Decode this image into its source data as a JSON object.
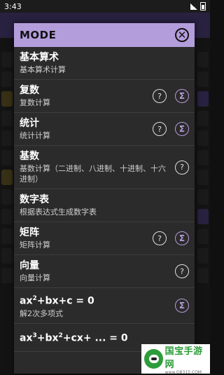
{
  "status_bar": {
    "time": "3:43"
  },
  "dialog": {
    "title": "MODE",
    "items": [
      {
        "title": "基本算术",
        "subtitle": "基本算术计算",
        "help": false,
        "sigma": false
      },
      {
        "title": "复数",
        "subtitle": "复数计算",
        "help": true,
        "sigma": true
      },
      {
        "title": "统计",
        "subtitle": "统计计算",
        "help": true,
        "sigma": true
      },
      {
        "title": "基数",
        "subtitle": "基数计算（二进制、八进制、十进制、十六进制）",
        "help": true,
        "sigma": false
      },
      {
        "title": "数字表",
        "subtitle": "根据表达式生成数字表",
        "help": false,
        "sigma": false
      },
      {
        "title": "矩阵",
        "subtitle": "矩阵计算",
        "help": true,
        "sigma": true
      },
      {
        "title": "向量",
        "subtitle": "向量计算",
        "help": true,
        "sigma": false
      },
      {
        "title_html_parts": [
          "ax",
          "2",
          "+bx+c = 0"
        ],
        "subtitle": "解2次多项式",
        "help": false,
        "sigma": true
      },
      {
        "title_html_parts": [
          "ax",
          "3",
          "+bx",
          "2",
          "+cx+ ... = 0"
        ],
        "subtitle": "",
        "help": false,
        "sigma": false
      }
    ]
  },
  "icons": {
    "help": "question-circle-icon",
    "sigma": "sigma-circle-icon",
    "close": "close-circle-icon"
  },
  "watermark": {
    "title": "国宝手游网",
    "url": "www.GB315.COM"
  },
  "colors": {
    "accent": "#b39ddb",
    "dialog_bg": "#2b2b2b",
    "watermark_green": "#2e9c3a"
  }
}
